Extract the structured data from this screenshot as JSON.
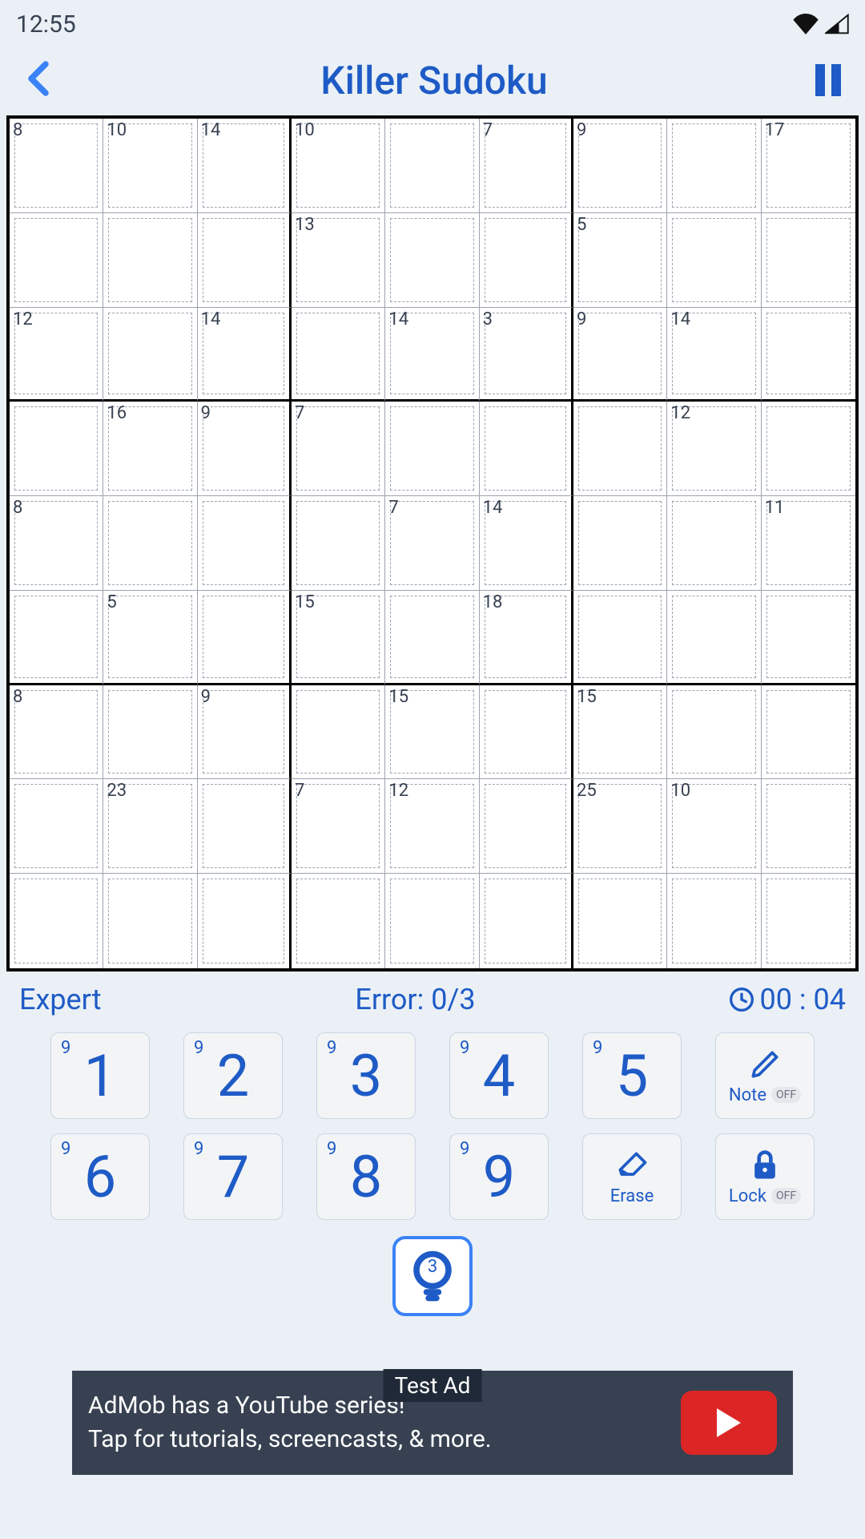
{
  "status": {
    "time": "12:55"
  },
  "header": {
    "title": "Killer Sudoku"
  },
  "info": {
    "difficulty": "Expert",
    "error_label": "Error: 0/3",
    "timer": "00 : 04"
  },
  "cages": [
    {
      "r": 0,
      "c": 0,
      "sum": 8
    },
    {
      "r": 0,
      "c": 1,
      "sum": 10
    },
    {
      "r": 0,
      "c": 2,
      "sum": 14
    },
    {
      "r": 0,
      "c": 3,
      "sum": 10
    },
    {
      "r": 0,
      "c": 5,
      "sum": 7
    },
    {
      "r": 0,
      "c": 6,
      "sum": 9
    },
    {
      "r": 0,
      "c": 8,
      "sum": 17
    },
    {
      "r": 1,
      "c": 3,
      "sum": 13
    },
    {
      "r": 1,
      "c": 6,
      "sum": 5
    },
    {
      "r": 2,
      "c": 0,
      "sum": 12
    },
    {
      "r": 2,
      "c": 2,
      "sum": 14
    },
    {
      "r": 2,
      "c": 4,
      "sum": 14
    },
    {
      "r": 2,
      "c": 5,
      "sum": 3
    },
    {
      "r": 2,
      "c": 6,
      "sum": 9
    },
    {
      "r": 2,
      "c": 7,
      "sum": 14
    },
    {
      "r": 3,
      "c": 1,
      "sum": 16
    },
    {
      "r": 3,
      "c": 2,
      "sum": 9
    },
    {
      "r": 3,
      "c": 3,
      "sum": 7
    },
    {
      "r": 3,
      "c": 7,
      "sum": 12
    },
    {
      "r": 4,
      "c": 0,
      "sum": 8
    },
    {
      "r": 4,
      "c": 4,
      "sum": 7
    },
    {
      "r": 4,
      "c": 5,
      "sum": 14
    },
    {
      "r": 4,
      "c": 8,
      "sum": 11
    },
    {
      "r": 5,
      "c": 1,
      "sum": 5
    },
    {
      "r": 5,
      "c": 3,
      "sum": 15
    },
    {
      "r": 5,
      "c": 5,
      "sum": 18
    },
    {
      "r": 6,
      "c": 0,
      "sum": 8
    },
    {
      "r": 6,
      "c": 2,
      "sum": 9
    },
    {
      "r": 6,
      "c": 4,
      "sum": 15
    },
    {
      "r": 6,
      "c": 6,
      "sum": 15
    },
    {
      "r": 7,
      "c": 1,
      "sum": 23
    },
    {
      "r": 7,
      "c": 3,
      "sum": 7
    },
    {
      "r": 7,
      "c": 4,
      "sum": 12
    },
    {
      "r": 7,
      "c": 6,
      "sum": 25
    },
    {
      "r": 7,
      "c": 7,
      "sum": 10
    }
  ],
  "numpad": {
    "nums": [
      "1",
      "2",
      "3",
      "4",
      "5",
      "6",
      "7",
      "8",
      "9"
    ],
    "remaining": [
      "9",
      "9",
      "9",
      "9",
      "9",
      "9",
      "9",
      "9",
      "9"
    ]
  },
  "tools": {
    "note": "Note",
    "note_state": "OFF",
    "erase": "Erase",
    "lock": "Lock",
    "lock_state": "OFF",
    "hints": "3"
  },
  "ad": {
    "label": "Test Ad",
    "line1": "AdMob has a YouTube series!",
    "line2": "Tap for tutorials, screencasts, & more."
  }
}
